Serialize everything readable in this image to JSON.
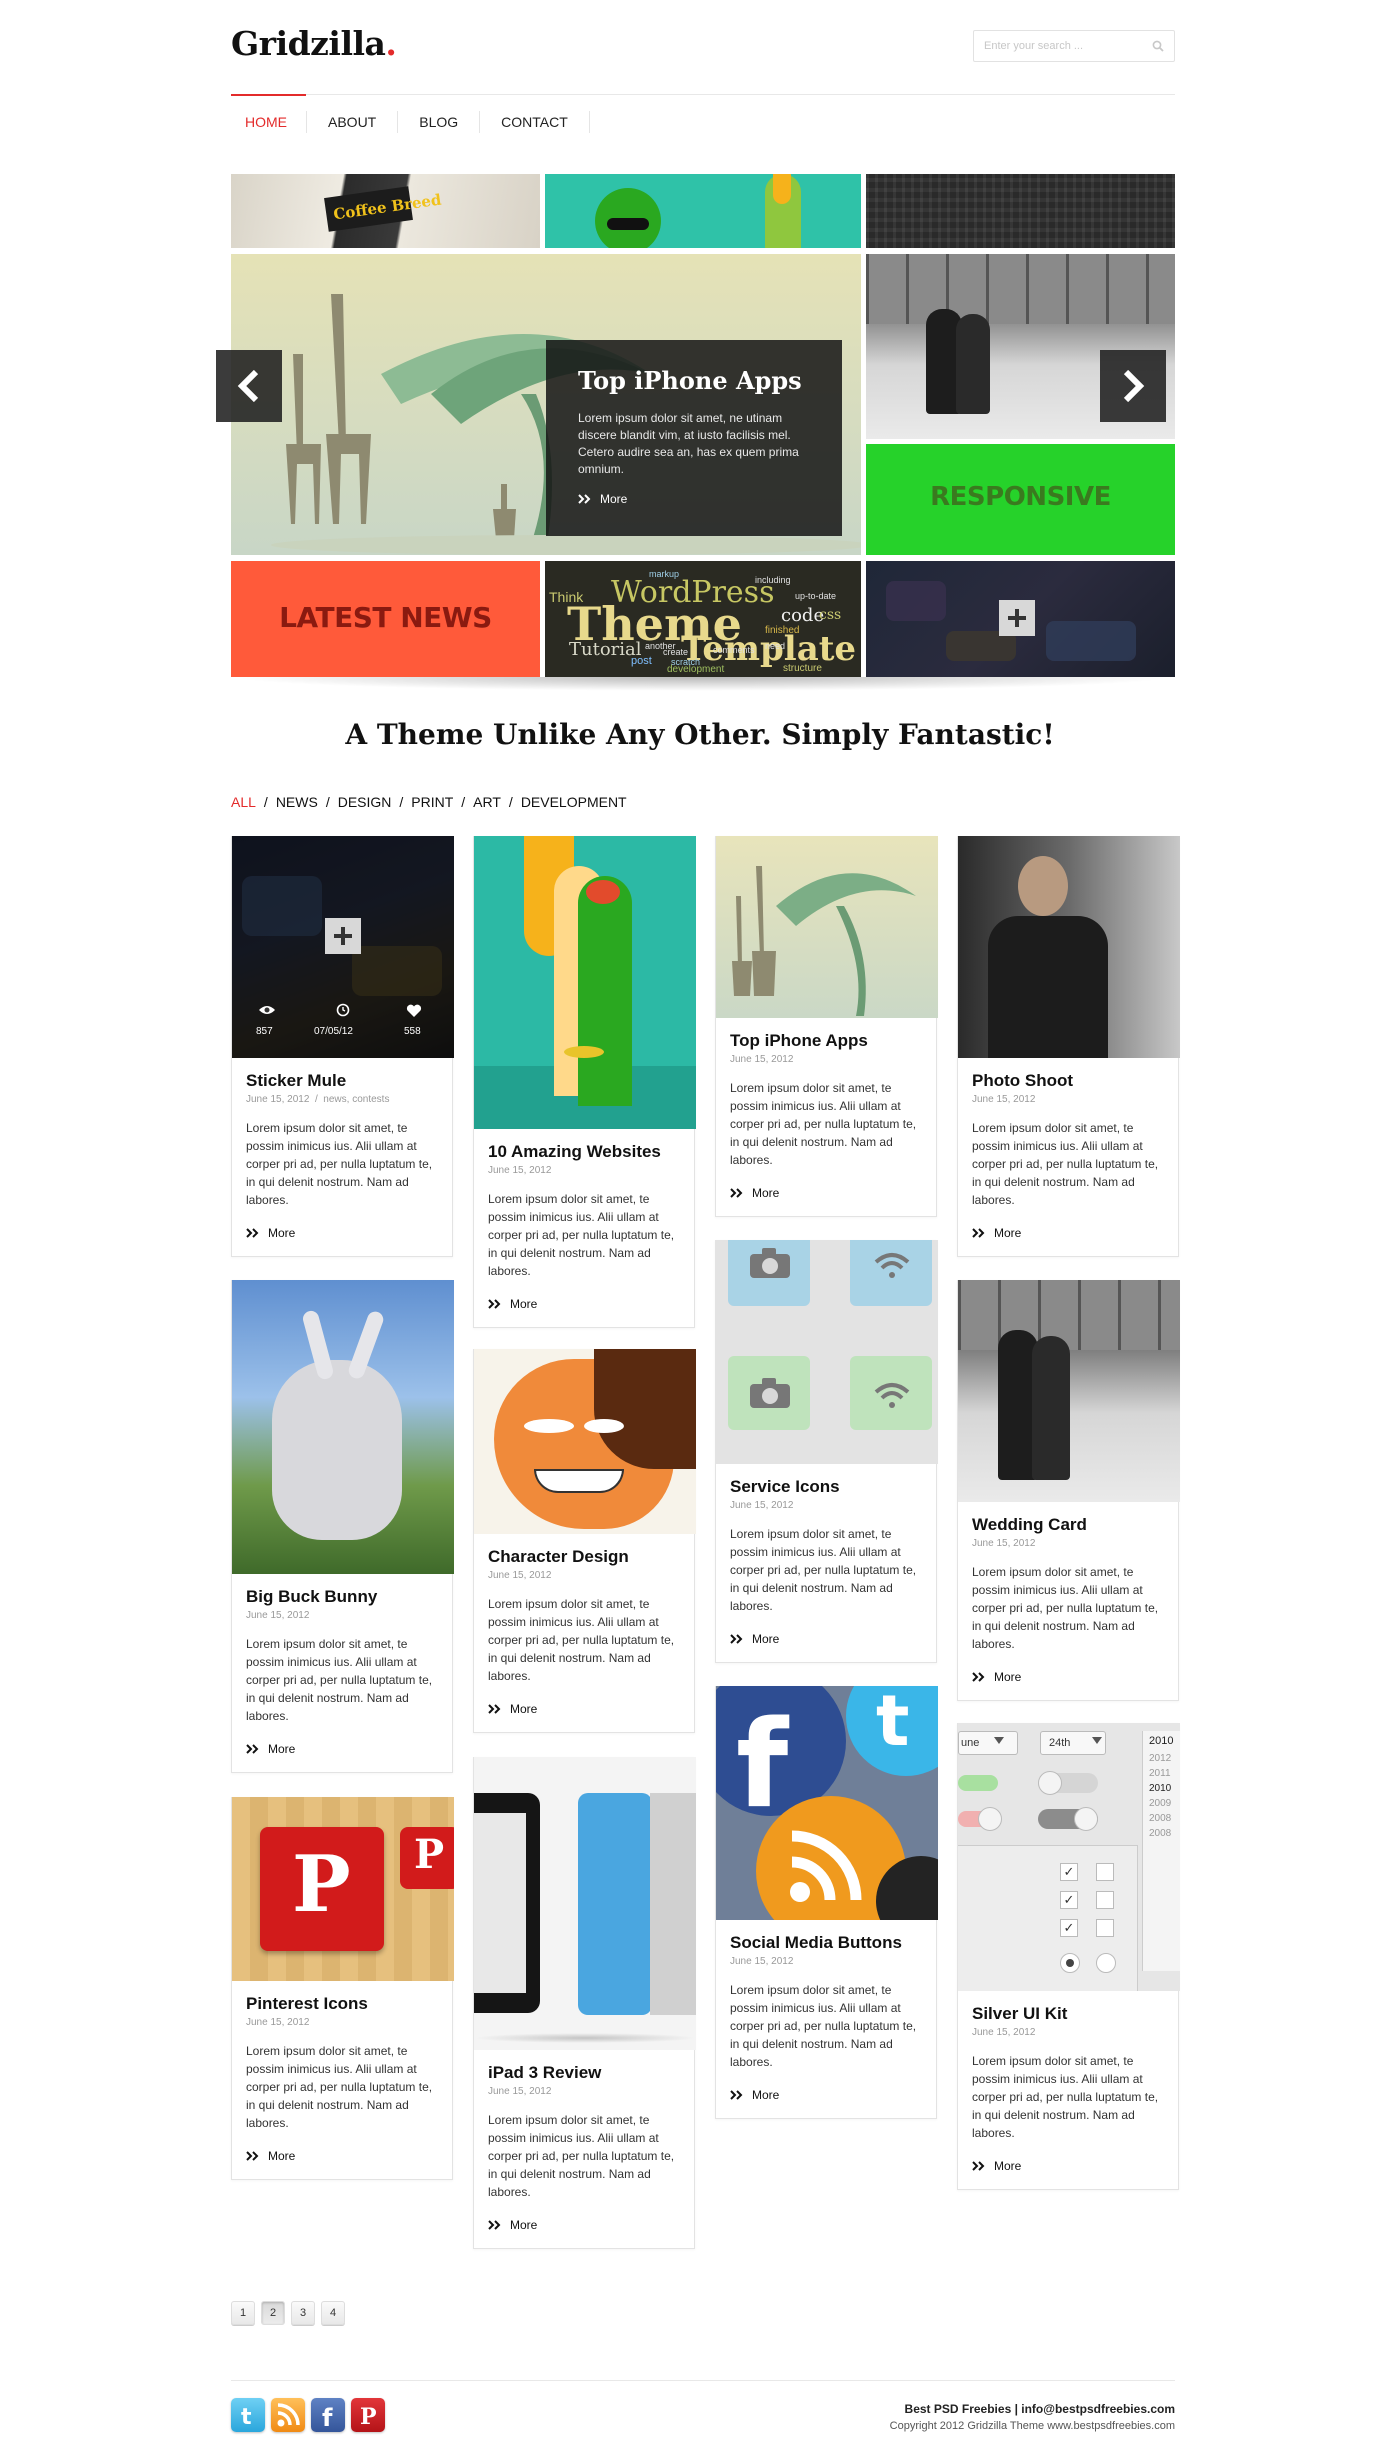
{
  "header": {
    "logo_text": "Gridzilla",
    "logo_dot": ".",
    "search_placeholder": "Enter your search ..."
  },
  "nav": {
    "items": [
      {
        "label": "HOME",
        "active": true
      },
      {
        "label": "ABOUT",
        "active": false
      },
      {
        "label": "BLOG",
        "active": false
      },
      {
        "label": "CONTACT",
        "active": false
      }
    ]
  },
  "slider": {
    "caption_title": "Top iPhone Apps",
    "caption_text": "Lorem ipsum dolor sit amet, ne utinam discere blandit vim, at iusto facilisis mel. Cetero audire sea an, has ex quem prima omnium.",
    "caption_more": "More",
    "tile_responsive": "RESPONSIVE",
    "tile_latest_news": "LATEST NEWS",
    "tile_coffee_text": "Coffee Breed",
    "word_cloud": [
      "WordPress",
      "Theme",
      "Template",
      "Tutorial",
      "code",
      "css",
      "markup",
      "structure",
      "development",
      "up-to-date",
      "finished",
      "comments",
      "including",
      "Think",
      "another",
      "post",
      "scratch",
      "need",
      "create"
    ]
  },
  "headline": "A Theme Unlike Any Other. Simply Fantastic!",
  "filters": {
    "items": [
      {
        "label": "ALL",
        "active": true
      },
      {
        "label": "NEWS",
        "active": false
      },
      {
        "label": "DESIGN",
        "active": false
      },
      {
        "label": "PRINT",
        "active": false
      },
      {
        "label": "ART",
        "active": false
      },
      {
        "label": "DEVELOPMENT",
        "active": false
      }
    ],
    "separator": "/"
  },
  "card_common": {
    "excerpt": "Lorem ipsum dolor sit amet, te possim inimicus ius. Alii ullam at corper pri ad, per nulla luptatum te, in qui delenit nostrum. Nam ad labores.",
    "more": "More",
    "date": "June 15, 2012"
  },
  "cards": [
    {
      "title": "Sticker Mule",
      "date": "June 15, 2012",
      "tags": "news, contests",
      "stats": {
        "views": "857",
        "date": "07/05/12",
        "likes": "558"
      }
    },
    {
      "title": "10 Amazing Websites",
      "date": "June 15, 2012"
    },
    {
      "title": "Top iPhone Apps",
      "date": "June 15, 2012"
    },
    {
      "title": "Photo Shoot",
      "date": "June 15, 2012"
    },
    {
      "title": "Big Buck Bunny",
      "date": "June 15, 2012"
    },
    {
      "title": "Character Design",
      "date": "June 15, 2012"
    },
    {
      "title": "Service Icons",
      "date": "June 15, 2012"
    },
    {
      "title": "Wedding Card",
      "date": "June 15, 2012"
    },
    {
      "title": "Pinterest Icons",
      "date": "June 15, 2012"
    },
    {
      "title": "iPad 3 Review",
      "date": "June 15, 2012"
    },
    {
      "title": "Social Media Buttons",
      "date": "June 15, 2012"
    },
    {
      "title": "Silver UI Kit",
      "date": "June 15, 2012"
    }
  ],
  "ui_kit": {
    "month": "une",
    "day": "24th",
    "years": [
      "2010",
      "2012",
      "2011",
      "2010",
      "2009",
      "2008",
      "2008"
    ]
  },
  "pagination": {
    "pages": [
      "1",
      "2",
      "3",
      "4"
    ],
    "current": "2"
  },
  "footer": {
    "line1": "Best PSD Freebies  |  info@bestpsdfreebies.com",
    "line2": "Copyright 2012 Gridzilla Theme  www.bestpsdfreebies.com",
    "social": [
      "twitter-icon",
      "rss-icon",
      "facebook-icon",
      "pinterest-icon"
    ]
  },
  "colors": {
    "accent_red": "#e32b2b",
    "responsive_green": "#26d22a",
    "latest_news_orange": "#ff5a3a"
  }
}
